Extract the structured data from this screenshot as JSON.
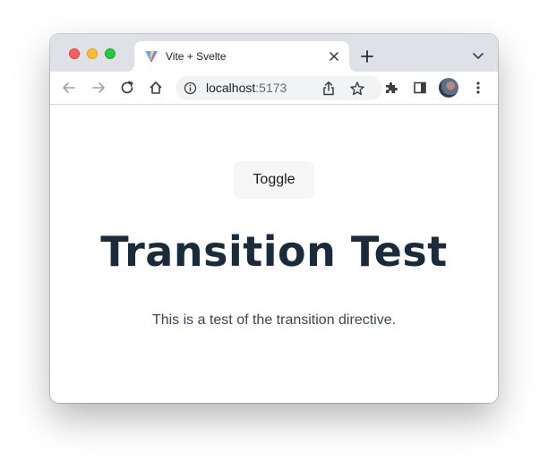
{
  "browser": {
    "tab": {
      "title": "Vite + Svelte",
      "favicon": "vite-logo-icon",
      "close_icon": "close-icon"
    },
    "new_tab_icon": "plus-icon",
    "tab_search_icon": "chevron-down-icon",
    "toolbar": {
      "back_icon": "arrow-left-icon",
      "forward_icon": "arrow-right-icon",
      "reload_icon": "reload-icon",
      "home_icon": "home-icon",
      "extensions_icon": "puzzle-icon",
      "side_panel_icon": "side-panel-icon",
      "menu_icon": "kebab-menu-icon"
    },
    "address": {
      "host": "localhost",
      "port": ":5173",
      "info_icon": "info-icon",
      "share_icon": "share-icon",
      "bookmark_icon": "star-icon"
    }
  },
  "page": {
    "toggle_label": "Toggle",
    "heading": "Transition Test",
    "description": "This is a test of the transition directive."
  },
  "colors": {
    "heading": "#1c2b3c",
    "button_bg": "#f6f6f6",
    "titlebar_bg": "#dee1e6"
  }
}
